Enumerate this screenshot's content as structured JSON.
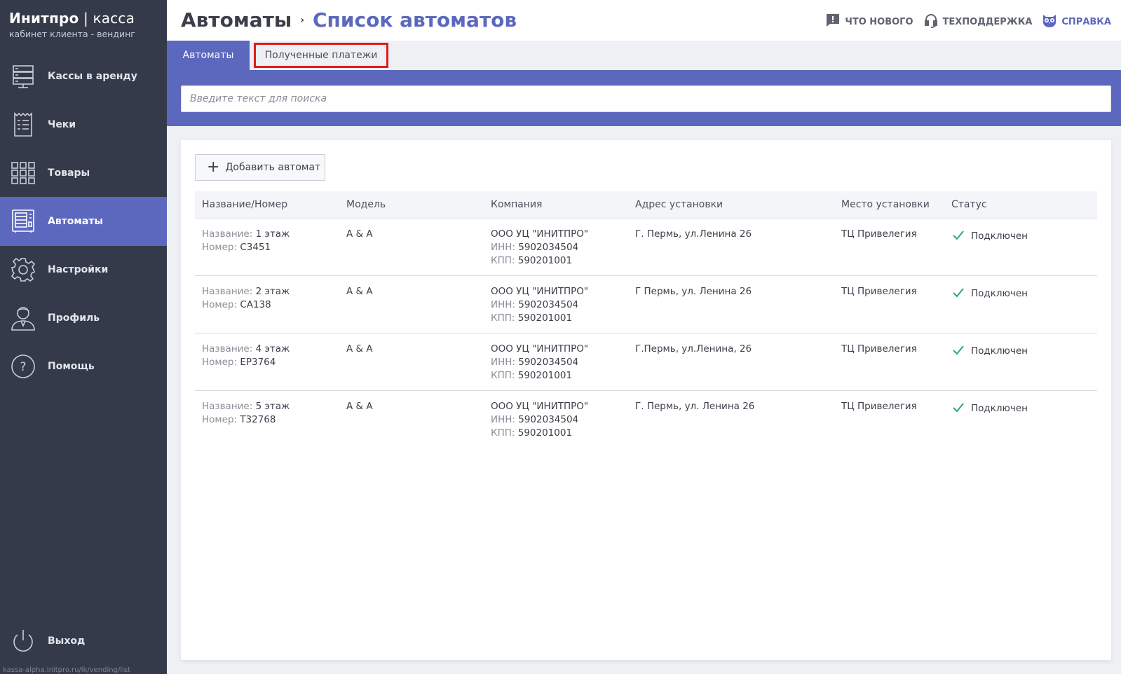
{
  "brand": {
    "name": "Инитпро",
    "separator": " | ",
    "product": "касса",
    "subtitle": "кабинет клиента - вендинг"
  },
  "sidebar": {
    "items": [
      {
        "label": "Кассы в аренду",
        "icon": "server-icon"
      },
      {
        "label": "Чеки",
        "icon": "receipt-icon"
      },
      {
        "label": "Товары",
        "icon": "grid-icon"
      },
      {
        "label": "Автоматы",
        "icon": "vending-machine-icon",
        "active": true
      },
      {
        "label": "Настройки",
        "icon": "gear-icon"
      },
      {
        "label": "Профиль",
        "icon": "user-icon"
      },
      {
        "label": "Помощь",
        "icon": "question-icon"
      }
    ],
    "logout": {
      "label": "Выход",
      "icon": "power-icon"
    },
    "status_url": "kassa-alpha.initpro.ru/lk/vending/list"
  },
  "header": {
    "breadcrumb_root": "Автоматы",
    "breadcrumb_sep": "›",
    "breadcrumb_current": "Список автоматов",
    "links": [
      {
        "label": "ЧТО НОВОГО",
        "icon": "news-icon"
      },
      {
        "label": "ТЕХПОДДЕРЖКА",
        "icon": "headset-icon"
      },
      {
        "label": "СПРАВКА",
        "icon": "owl-icon"
      }
    ]
  },
  "tabs": [
    {
      "label": "Автоматы",
      "active": true
    },
    {
      "label": "Полученные платежи",
      "active": false
    }
  ],
  "search": {
    "placeholder": "Введите текст для поиска"
  },
  "add_button": {
    "label": "Добавить автомат"
  },
  "table": {
    "columns": [
      "Название/Номер",
      "Модель",
      "Компания",
      "Адрес установки",
      "Место установки",
      "Статус"
    ],
    "labels": {
      "name": "Название: ",
      "number": "Номер: ",
      "inn": "ИНН: ",
      "kpp": "КПП: "
    },
    "rows": [
      {
        "name": "1 этаж",
        "number": "С3451",
        "model": "А & А",
        "company": "ООО УЦ \"ИНИТПРО\"",
        "inn": "5902034504",
        "kpp": "590201001",
        "address": "Г. Пермь, ул.Ленина 26",
        "place": "ТЦ Привелегия",
        "status": "Подключен"
      },
      {
        "name": "2 этаж",
        "number": "СА138",
        "model": "А & А",
        "company": "ООО УЦ \"ИНИТПРО\"",
        "inn": "5902034504",
        "kpp": "590201001",
        "address": "Г Пермь, ул. Ленина 26",
        "place": "ТЦ Привелегия",
        "status": "Подключен"
      },
      {
        "name": "4 этаж",
        "number": "ЕР3764",
        "model": "А & А",
        "company": "ООО УЦ \"ИНИТПРО\"",
        "inn": "5902034504",
        "kpp": "590201001",
        "address": "Г.Пермь, ул.Ленина, 26",
        "place": "ТЦ Привелегия",
        "status": "Подключен"
      },
      {
        "name": "5 этаж",
        "number": "Т32768",
        "model": "А & А",
        "company": "ООО УЦ \"ИНИТПРО\"",
        "inn": "5902034504",
        "kpp": "590201001",
        "address": "Г. Пермь, ул. Ленина 26",
        "place": "ТЦ Привелегия",
        "status": "Подключен"
      }
    ]
  },
  "colors": {
    "accent": "#5c68be",
    "sidebar": "#343a4a",
    "success": "#2aa58a",
    "highlight": "#e01b1b"
  }
}
